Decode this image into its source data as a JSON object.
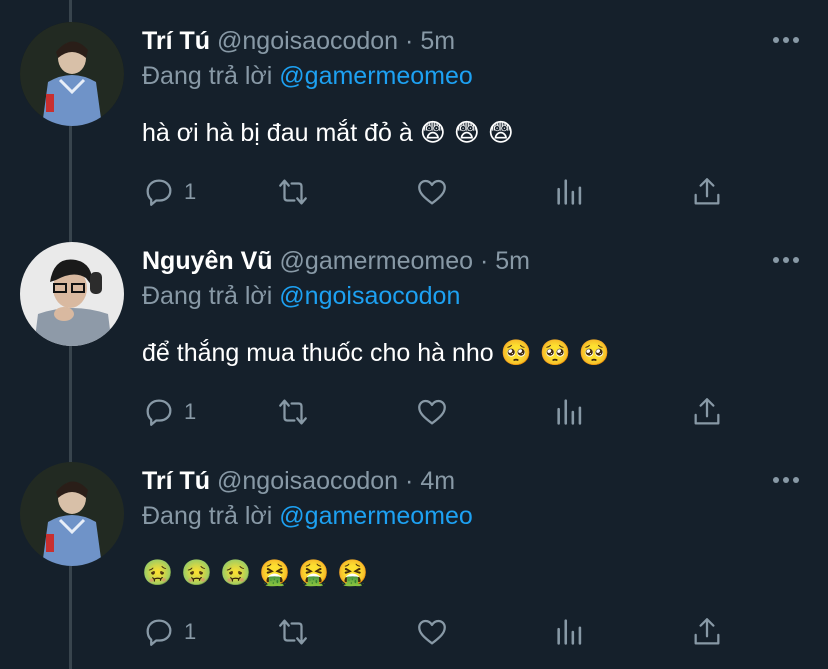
{
  "tweets": [
    {
      "name": "Trí Tú",
      "handle": "@ngoisaocodon",
      "time": "· 5m",
      "reply_prefix": "Đang trả lời",
      "reply_to": "@gamermeomeo",
      "text": "hà ơi hà bị đau mắt đỏ à",
      "emoji": "😨 😨 😨",
      "reply_count": "1",
      "avatar": "avatar-photo-1"
    },
    {
      "name": "Nguyên Vũ",
      "handle": "@gamermeomeo",
      "time": "· 5m",
      "reply_prefix": "Đang trả lời",
      "reply_to": "@ngoisaocodon",
      "text": "để thắng mua thuốc cho hà nho",
      "emoji": "🥺 🥺 🥺",
      "reply_count": "1",
      "avatar": "avatar-photo-2"
    },
    {
      "name": "Trí Tú",
      "handle": "@ngoisaocodon",
      "time": "· 4m",
      "reply_prefix": "Đang trả lời",
      "reply_to": "@gamermeomeo",
      "text": "",
      "emoji": "🤢 🤢 🤢 🤮 🤮 🤮",
      "reply_count": "1",
      "avatar": "avatar-photo-1"
    }
  ],
  "colors": {
    "background": "#15202b",
    "text_primary": "#ffffff",
    "text_secondary": "#8899a6",
    "mention": "#1da1f2",
    "thread_line": "#38444d"
  },
  "icons": [
    "more-icon",
    "reply-icon",
    "retweet-icon",
    "like-icon",
    "stats-icon",
    "share-icon"
  ]
}
